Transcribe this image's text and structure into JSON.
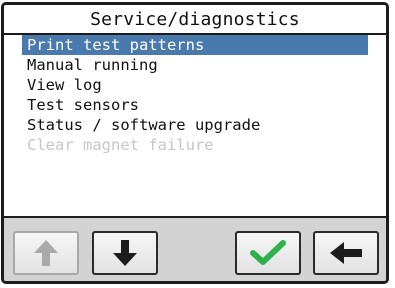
{
  "screen": {
    "title": "Service/diagnostics"
  },
  "menu": {
    "items": [
      {
        "label": "Print test patterns",
        "state": "selected"
      },
      {
        "label": "Manual running",
        "state": "normal"
      },
      {
        "label": "View log",
        "state": "normal"
      },
      {
        "label": "Test sensors",
        "state": "normal"
      },
      {
        "label": "Status / software upgrade",
        "state": "normal"
      },
      {
        "label": "Clear magnet failure",
        "state": "disabled"
      }
    ]
  },
  "toolbar": {
    "buttons": [
      {
        "icon": "arrow-up-icon",
        "enabled": false
      },
      {
        "icon": "arrow-down-icon",
        "enabled": true
      },
      {
        "icon": "checkmark-icon",
        "enabled": true
      },
      {
        "icon": "arrow-left-icon",
        "enabled": true
      }
    ]
  },
  "colors": {
    "selection": "#4a79ad",
    "disabled_text": "#c6c6c6",
    "confirm_green": "#2fb14a",
    "toolbar_bg": "#d3d3d3"
  }
}
